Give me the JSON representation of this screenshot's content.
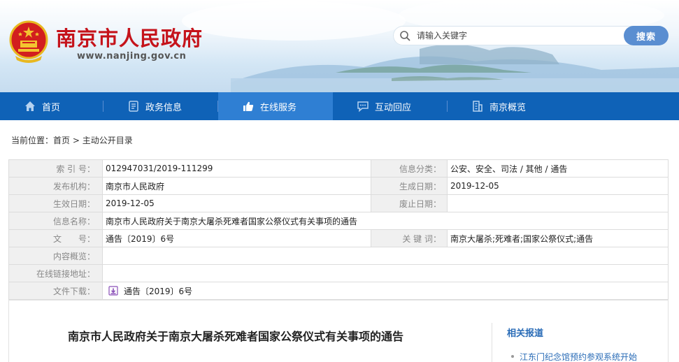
{
  "header": {
    "site_title": "南京市人民政府",
    "site_url": "www.nanjing.gov.cn",
    "search_placeholder": "请输入关键字",
    "search_button": "搜索"
  },
  "nav": {
    "items": [
      {
        "label": "首页",
        "icon": "home-icon"
      },
      {
        "label": "政务信息",
        "icon": "document-icon"
      },
      {
        "label": "在线服务",
        "icon": "thumbs-up-icon",
        "active": true
      },
      {
        "label": "互动回应",
        "icon": "chat-icon"
      },
      {
        "label": "南京概览",
        "icon": "building-icon"
      }
    ]
  },
  "breadcrumb": {
    "prefix": "当前位置：",
    "home": "首页",
    "sep": " > ",
    "current": "主动公开目录"
  },
  "meta": {
    "index_no_label": "索 引 号：",
    "index_no": "012947031/2019-111299",
    "category_label": "信息分类：",
    "category": "公安、安全、司法 / 其他 / 通告",
    "publisher_label": "发布机构：",
    "publisher": "南京市人民政府",
    "created_label": "生成日期：",
    "created": "2019-12-05",
    "effective_label": "生效日期：",
    "effective": "2019-12-05",
    "abolished_label": "废止日期：",
    "abolished": "",
    "info_name_label": "信息名称：",
    "info_name": "南京市人民政府关于南京大屠杀死难者国家公祭仪式有关事项的通告",
    "doc_no_label": "文　　号：",
    "doc_no": "通告〔2019〕6号",
    "keywords_label": "关 键 词：",
    "keywords": "南京大屠杀;死难者;国家公祭仪式;通告",
    "summary_label": "内容概览：",
    "summary": "",
    "online_link_label": "在线链接地址：",
    "online_link": "",
    "download_label": "文件下载：",
    "download": "通告〔2019〕6号"
  },
  "article": {
    "title": "南京市人民政府关于南京大屠杀死难者国家公祭仪式有关事项的通告",
    "related_title": "相关报道",
    "related_items": [
      "江东门纪念馆预约参观系统开始"
    ]
  },
  "colors": {
    "brand_red": "#c5131b",
    "nav_blue": "#0f62b7",
    "nav_active": "#2f7fd3",
    "link_blue": "#2a6cb7"
  }
}
